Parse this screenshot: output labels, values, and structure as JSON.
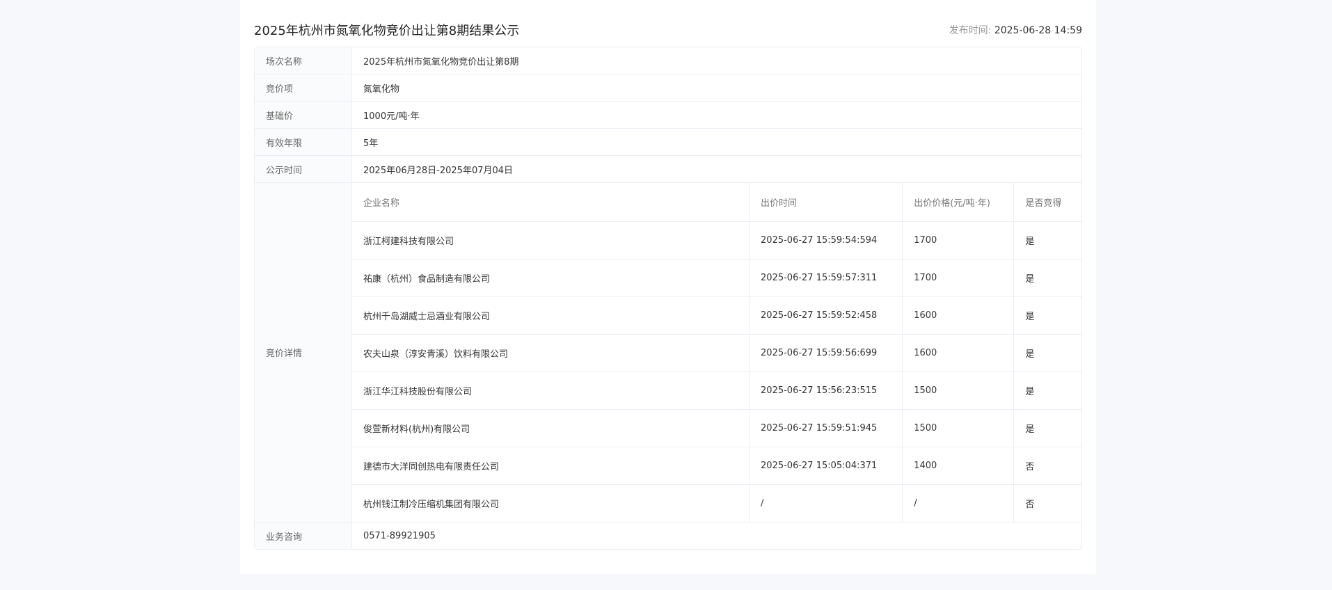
{
  "header": {
    "title": "2025年杭州市氮氧化物竞价出让第8期结果公示",
    "pub_label": "发布时间:",
    "pub_value": "2025-06-28 14:59"
  },
  "info": {
    "session_label": "场次名称",
    "session_value": "2025年杭州市氮氧化物竞价出让第8期",
    "item_label": "竞价项",
    "item_value": "氮氧化物",
    "base_label": "基础价",
    "base_value": "1000元/吨·年",
    "validity_label": "有效年限",
    "validity_value": "5年",
    "notice_label": "公示时间",
    "notice_value": "2025年06月28日-2025年07月04日",
    "detail_label": "竞价详情",
    "consult_label": "业务咨询",
    "consult_value": "0571-89921905"
  },
  "bids": {
    "columns": [
      "企业名称",
      "出价时间",
      "出价价格(元/吨·年)",
      "是否竞得"
    ],
    "rows": [
      [
        "浙江柯建科技有限公司",
        "2025-06-27 15:59:54:594",
        "1700",
        "是"
      ],
      [
        "祐康（杭州）食品制造有限公司",
        "2025-06-27 15:59:57:311",
        "1700",
        "是"
      ],
      [
        "杭州千岛湖威士忌酒业有限公司",
        "2025-06-27 15:59:52:458",
        "1600",
        "是"
      ],
      [
        "农夫山泉（淳安青溪）饮料有限公司",
        "2025-06-27 15:59:56:699",
        "1600",
        "是"
      ],
      [
        "浙江华江科技股份有限公司",
        "2025-06-27 15:56:23:515",
        "1500",
        "是"
      ],
      [
        "俊萱新材料(杭州)有限公司",
        "2025-06-27 15:59:51:945",
        "1500",
        "是"
      ],
      [
        "建德市大洋同创热电有限责任公司",
        "2025-06-27 15:05:04:371",
        "1400",
        "否"
      ],
      [
        "杭州钱江制冷压缩机集团有限公司",
        "/",
        "/",
        "否"
      ]
    ]
  }
}
